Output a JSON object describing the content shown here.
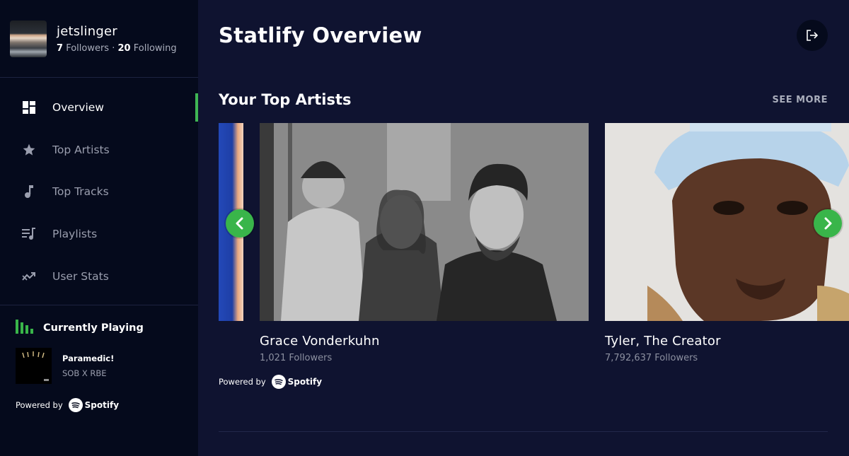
{
  "profile": {
    "username": "jetslinger",
    "followers": "7",
    "followers_label": "Followers",
    "separator": "·",
    "following": "20",
    "following_label": "Following"
  },
  "nav": {
    "items": [
      {
        "label": "Overview",
        "icon": "dashboard-icon",
        "active": true
      },
      {
        "label": "Top Artists",
        "icon": "star-icon",
        "active": false
      },
      {
        "label": "Top Tracks",
        "icon": "music-note-icon",
        "active": false
      },
      {
        "label": "Playlists",
        "icon": "playlist-icon",
        "active": false
      },
      {
        "label": "User Stats",
        "icon": "trend-icon",
        "active": false
      }
    ]
  },
  "now_playing": {
    "heading": "Currently Playing",
    "title": "Paramedic!",
    "artist": "SOB X RBE"
  },
  "powered": {
    "text": "Powered by",
    "brand": "Spotify"
  },
  "header": {
    "title": "Statlify Overview"
  },
  "top_artists": {
    "title": "Your Top Artists",
    "see_more": "SEE MORE",
    "artists": [
      {
        "name": "Grace Vonderkuhn",
        "followers": "1,021 Followers"
      },
      {
        "name": "Tyler, The Creator",
        "followers": "7,792,637 Followers"
      }
    ]
  },
  "colors": {
    "background": "#0f1330",
    "sidebar": "#050a1c",
    "accent": "#39b54a"
  }
}
